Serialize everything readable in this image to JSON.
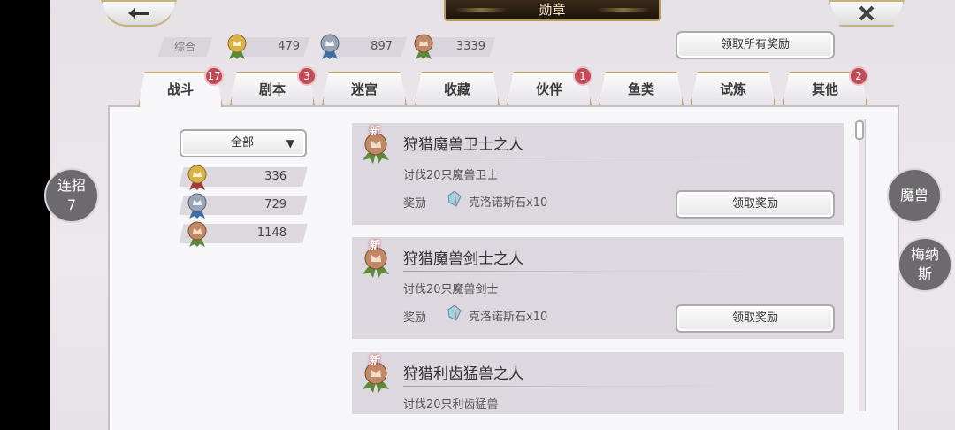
{
  "header": {
    "title": "勋章"
  },
  "summary": {
    "label": "综合",
    "gold": "479",
    "silver": "897",
    "bronze": "3339"
  },
  "claim_all_label": "领取所有奖励",
  "tabs": [
    {
      "label": "战斗",
      "badge": "17"
    },
    {
      "label": "剧本",
      "badge": "3"
    },
    {
      "label": "迷宫",
      "badge": ""
    },
    {
      "label": "收藏",
      "badge": ""
    },
    {
      "label": "伙伴",
      "badge": "1"
    },
    {
      "label": "鱼类",
      "badge": ""
    },
    {
      "label": "试炼",
      "badge": ""
    },
    {
      "label": "其他",
      "badge": "2"
    }
  ],
  "filter": {
    "selected": "全部"
  },
  "stats": {
    "gold": "336",
    "silver": "729",
    "bronze": "1148"
  },
  "cards": [
    {
      "new": "新",
      "title": "狩猎魔兽卫士之人",
      "desc": "讨伐20只魔兽卫士",
      "reward_label": "奖励",
      "reward": "克洛诺斯石x10",
      "button": "领取奖励"
    },
    {
      "new": "新",
      "title": "狩猎魔兽剑士之人",
      "desc": "讨伐20只魔兽剑士",
      "reward_label": "奖励",
      "reward": "克洛诺斯石x10",
      "button": "领取奖励"
    },
    {
      "new": "新",
      "title": "狩猎利齿猛兽之人",
      "desc": "讨伐20只利齿猛兽"
    }
  ],
  "side_left": {
    "line1": "连招",
    "line2": "7"
  },
  "side_right": [
    {
      "line1": "魔兽",
      "line2": ""
    },
    {
      "line1": "梅纳",
      "line2": "斯"
    }
  ],
  "colors": {
    "gold": "#d9b24a",
    "silver": "#9aa6b6",
    "bronze": "#c08a66",
    "badge": "#c14b57"
  }
}
